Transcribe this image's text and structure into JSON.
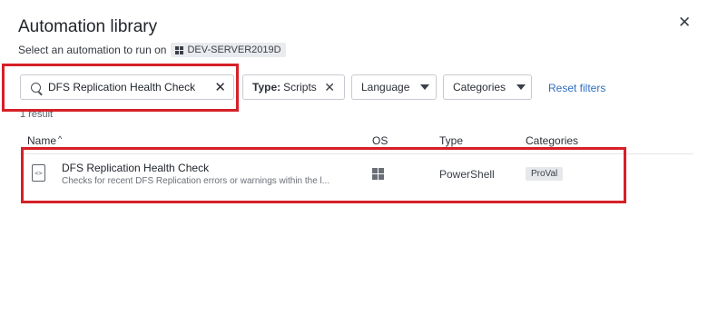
{
  "dialog": {
    "title": "Automation library",
    "subtitle": "Select an automation to run on",
    "device": "DEV-SERVER2019D"
  },
  "search": {
    "value": "DFS Replication Health Check"
  },
  "filters": {
    "type_label": "Type:",
    "type_value": "Scripts",
    "language": "Language",
    "categories": "Categories",
    "reset": "Reset filters"
  },
  "result_count": "1 result",
  "table": {
    "columns": [
      "Name",
      "OS",
      "Type",
      "Categories"
    ],
    "rows": [
      {
        "name": "DFS Replication Health Check",
        "description": "Checks for recent DFS Replication errors or warnings within the l...",
        "os": "windows-icon",
        "type": "PowerShell",
        "category": "ProVal"
      }
    ]
  },
  "icons": {
    "close": "close-icon",
    "search": "search-icon",
    "script": "script-file-icon"
  },
  "colors": {
    "highlight": "#d62028",
    "link": "#2f6fbf"
  }
}
